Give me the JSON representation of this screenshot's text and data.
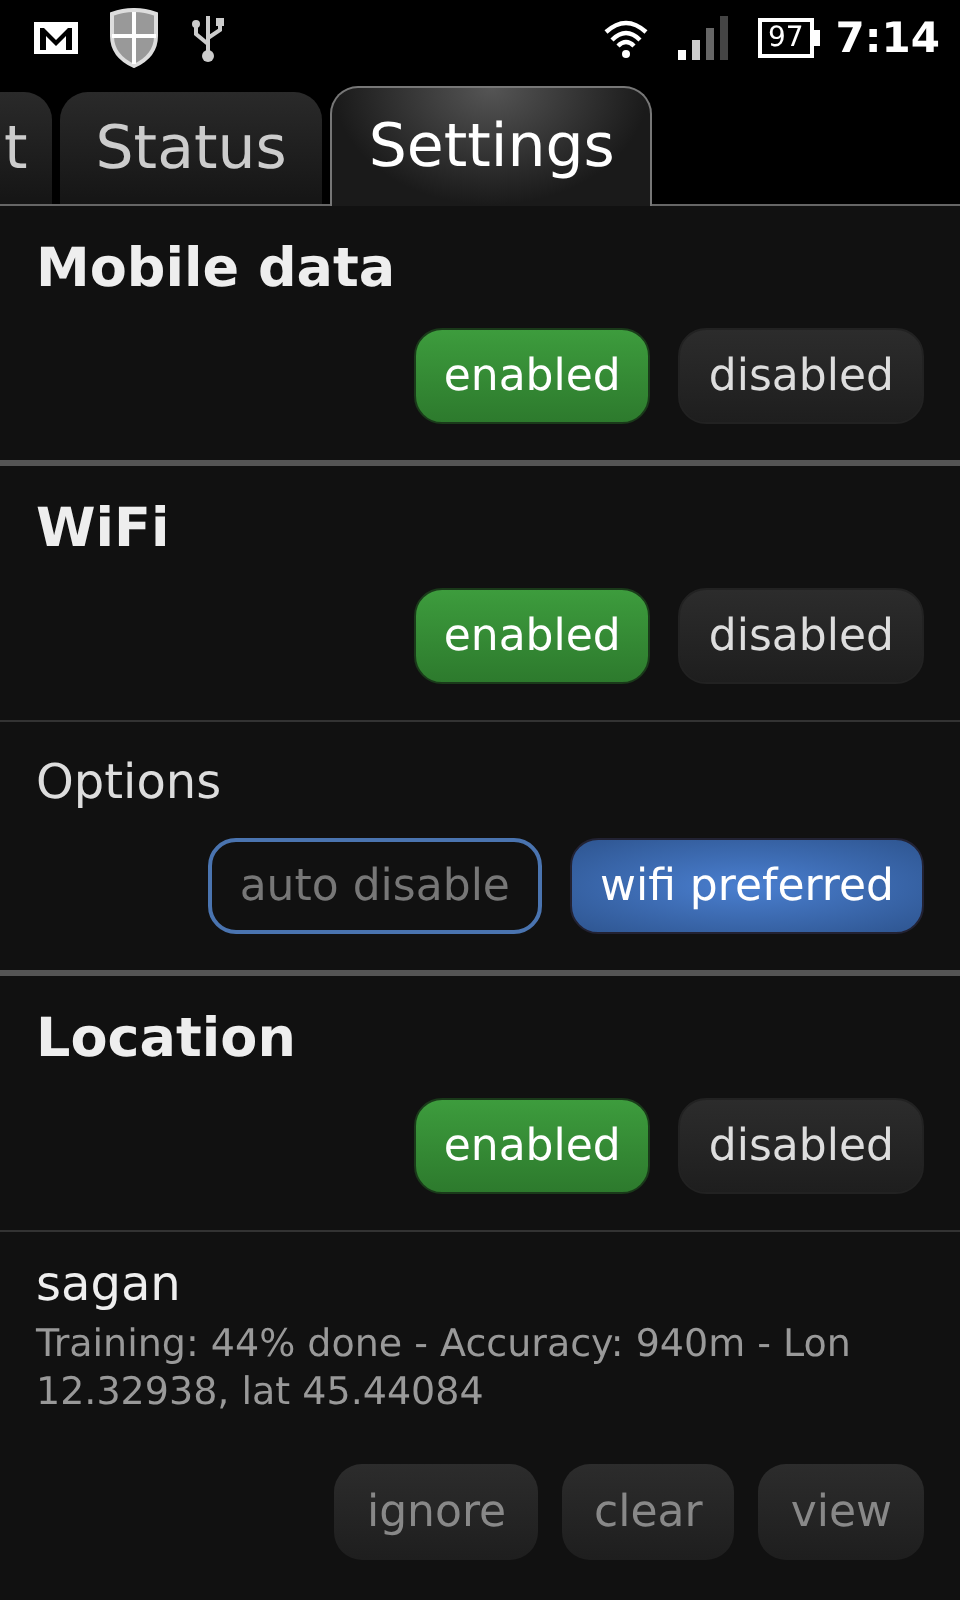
{
  "status_bar": {
    "battery": "97",
    "time": "7:14"
  },
  "tabs": [
    {
      "label": "t",
      "selected": false
    },
    {
      "label": "Status",
      "selected": false
    },
    {
      "label": "Settings",
      "selected": true
    }
  ],
  "sections": [
    {
      "kind": "switch",
      "title": "Mobile data",
      "buttons": [
        {
          "label": "enabled",
          "selected": true
        },
        {
          "label": "disabled",
          "selected": false
        }
      ]
    },
    {
      "kind": "switch",
      "title": "WiFi",
      "buttons": [
        {
          "label": "enabled",
          "selected": true
        },
        {
          "label": "disabled",
          "selected": false
        }
      ]
    },
    {
      "kind": "options",
      "title": "Options",
      "buttons": [
        {
          "label": "auto disable",
          "selected": false
        },
        {
          "label": "wifi preferred",
          "selected": true
        }
      ]
    },
    {
      "kind": "switch",
      "title": "Location",
      "buttons": [
        {
          "label": "enabled",
          "selected": true
        },
        {
          "label": "disabled",
          "selected": false
        }
      ]
    },
    {
      "kind": "device",
      "title": "sagan",
      "detail": "Training: 44% done - Accuracy: 940m - Lon 12.32938, lat 45.44084",
      "buttons": [
        {
          "label": "ignore"
        },
        {
          "label": "clear"
        },
        {
          "label": "view"
        }
      ]
    }
  ]
}
